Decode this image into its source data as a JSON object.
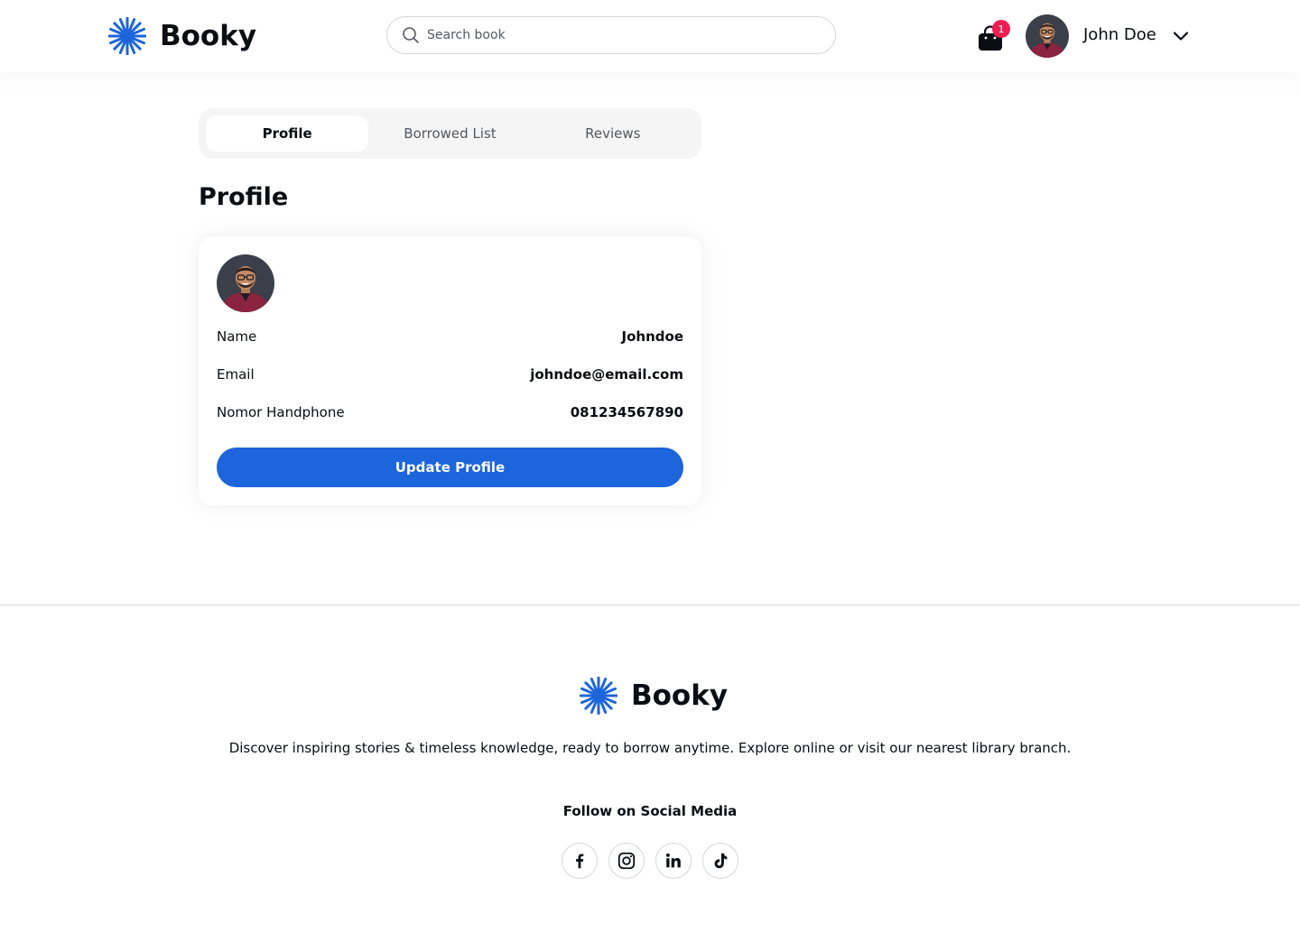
{
  "header": {
    "brand": "Booky",
    "search_placeholder": "Search book",
    "cart_count": "1",
    "user_name": "John Doe"
  },
  "tabs": [
    {
      "label": "Profile",
      "active": true
    },
    {
      "label": "Borrowed List",
      "active": false
    },
    {
      "label": "Reviews",
      "active": false
    }
  ],
  "page_title": "Profile",
  "profile": {
    "fields": [
      {
        "label": "Name",
        "value": "Johndoe"
      },
      {
        "label": "Email",
        "value": "johndoe@email.com"
      },
      {
        "label": "Nomor Handphone",
        "value": "081234567890"
      }
    ],
    "update_button": "Update Profile"
  },
  "footer": {
    "brand": "Booky",
    "description": "Discover inspiring stories & timeless knowledge, ready to borrow anytime. Explore online or visit our nearest library branch.",
    "social_title": "Follow on Social Media",
    "socials": [
      "facebook-icon",
      "instagram-icon",
      "linkedin-icon",
      "tiktok-icon"
    ]
  },
  "colors": {
    "accent": "#1c65da",
    "badge": "#ee1d52",
    "text": "#0a0d12",
    "muted": "#535862",
    "border": "#d5d7da"
  }
}
